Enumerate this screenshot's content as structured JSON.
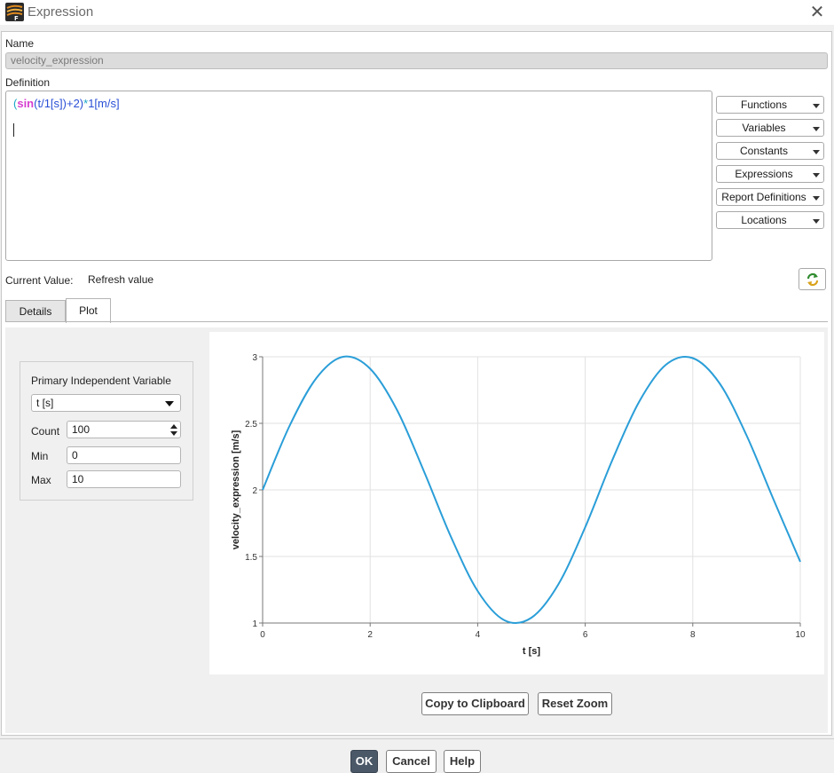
{
  "window": {
    "title": "Expression",
    "close_icon": "close-icon",
    "app_icon": "fluent-app-icon"
  },
  "name": {
    "label": "Name",
    "value": "velocity_expression"
  },
  "definition": {
    "label": "Definition",
    "tokens": {
      "open": "(",
      "sin": "sin",
      "arg": "(t/1[s])",
      "plus": "+2)",
      "mul": "*",
      "unit": "1[m/s]"
    }
  },
  "side_buttons": [
    "Functions",
    "Variables",
    "Constants",
    "Expressions",
    "Report Definitions",
    "Locations"
  ],
  "current_value": {
    "label": "Current Value:",
    "value": "Refresh value",
    "refresh_icon": "refresh-icon"
  },
  "tabs": {
    "details": "Details",
    "plot": "Plot",
    "active": "Plot"
  },
  "plot_settings": {
    "group_title": "Primary Independent Variable",
    "variable": "t [s]",
    "count_label": "Count",
    "count": "100",
    "min_label": "Min",
    "min": "0",
    "max_label": "Max",
    "max": "10"
  },
  "chart_data": {
    "type": "line",
    "title": "",
    "xlabel": "t [s]",
    "ylabel": "velocity_expression [m/s]",
    "xlim": [
      0,
      10
    ],
    "ylim": [
      1,
      3
    ],
    "xticks": [
      0,
      2,
      4,
      6,
      8,
      10
    ],
    "yticks": [
      1,
      1.5,
      2,
      2.5,
      3
    ],
    "grid": true,
    "legend": "none",
    "series": [
      {
        "color": "#2a9ed8",
        "x": [
          0,
          0.5,
          1,
          1.5,
          2,
          2.5,
          3,
          3.5,
          4,
          4.5,
          5,
          5.5,
          6,
          6.5,
          7,
          7.5,
          8,
          8.5,
          9,
          9.5,
          10
        ],
        "y": [
          2,
          2.48,
          2.84,
          3.0,
          2.91,
          2.6,
          2.14,
          1.65,
          1.24,
          1.02,
          1.04,
          1.29,
          1.72,
          2.22,
          2.66,
          2.94,
          2.99,
          2.8,
          2.41,
          1.93,
          1.46
        ]
      }
    ]
  },
  "plot_buttons": {
    "copy": "Copy to Clipboard",
    "reset": "Reset Zoom"
  },
  "footer": {
    "ok": "OK",
    "cancel": "Cancel",
    "help": "Help"
  }
}
